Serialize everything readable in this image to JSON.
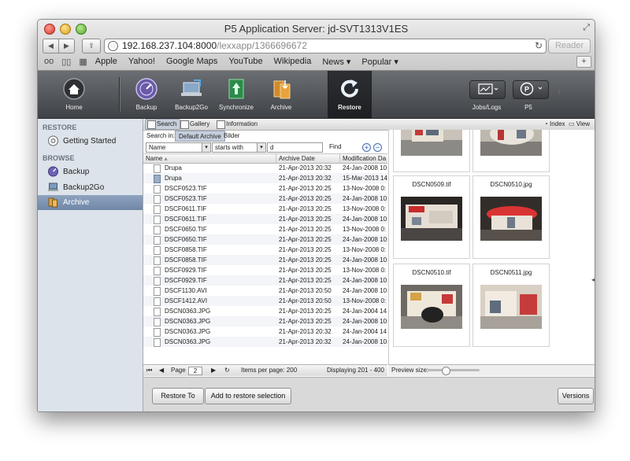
{
  "browser": {
    "window_title": "P5 Application Server: jd-SVT1313V1ES",
    "url_host": "192.168.237.104:8000",
    "url_path": "/lexxapp/1366696672",
    "reader_label": "Reader",
    "bookmarks": [
      "Apple",
      "Yahoo!",
      "Google Maps",
      "YouTube",
      "Wikipedia",
      "News ▾",
      "Popular ▾"
    ]
  },
  "toolbar": {
    "home": "Home",
    "backup": "Backup",
    "backup2go": "Backup2Go",
    "synchronize": "Synchronize",
    "archive": "Archive",
    "restore": "Restore",
    "jobs_logs": "Jobs/Logs",
    "p5": "P5"
  },
  "sidebar": {
    "restore_heading": "RESTORE",
    "getting_started": "Getting Started",
    "browse_heading": "BROWSE",
    "items": [
      "Backup",
      "Backup2Go",
      "Archive"
    ]
  },
  "tabs": {
    "search": "Search",
    "gallery": "Gallery",
    "information": "Information",
    "index": "Index",
    "view": "View"
  },
  "search": {
    "search_in_label": "Search in:",
    "scope_default": "Default Archive",
    "scope_bilder": "Bilder",
    "field": "Name",
    "operator": "starts with",
    "value": "d",
    "find_label": "Find"
  },
  "grid": {
    "columns": [
      "Name",
      "Archive Date",
      "Modification Da"
    ],
    "rows": [
      {
        "name": "Drupa",
        "archived": "21-Apr-2013 20:32",
        "modified": "24-Jan-2008 10:",
        "folder": false
      },
      {
        "name": "Drupa",
        "archived": "21-Apr-2013 20:32",
        "modified": "15-Mar-2013 14",
        "folder": true
      },
      {
        "name": "DSCF0523.TIF",
        "archived": "21-Apr-2013 20:25",
        "modified": "13-Nov-2008 0:",
        "folder": false
      },
      {
        "name": "DSCF0523.TIF",
        "archived": "21-Apr-2013 20:25",
        "modified": "24-Jan-2008 10:",
        "folder": false
      },
      {
        "name": "DSCF0611.TIF",
        "archived": "21-Apr-2013 20:25",
        "modified": "13-Nov-2008 0:",
        "folder": false
      },
      {
        "name": "DSCF0611.TIF",
        "archived": "21-Apr-2013 20:25",
        "modified": "24-Jan-2008 10:",
        "folder": false
      },
      {
        "name": "DSCF0650.TIF",
        "archived": "21-Apr-2013 20:25",
        "modified": "13-Nov-2008 0:",
        "folder": false
      },
      {
        "name": "DSCF0650.TIF",
        "archived": "21-Apr-2013 20:25",
        "modified": "24-Jan-2008 10:",
        "folder": false
      },
      {
        "name": "DSCF0858.TIF",
        "archived": "21-Apr-2013 20:25",
        "modified": "13-Nov-2008 0:",
        "folder": false
      },
      {
        "name": "DSCF0858.TIF",
        "archived": "21-Apr-2013 20:25",
        "modified": "24-Jan-2008 10:",
        "folder": false
      },
      {
        "name": "DSCF0929.TIF",
        "archived": "21-Apr-2013 20:25",
        "modified": "13-Nov-2008 0:",
        "folder": false
      },
      {
        "name": "DSCF0929.TIF",
        "archived": "21-Apr-2013 20:25",
        "modified": "24-Jan-2008 10:",
        "folder": false
      },
      {
        "name": "DSCF1130.AVI",
        "archived": "21-Apr-2013 20:50",
        "modified": "24-Jan-2008 10:",
        "folder": false
      },
      {
        "name": "DSCF1412.AVI",
        "archived": "21-Apr-2013 20:50",
        "modified": "13-Nov-2008 0:",
        "folder": false
      },
      {
        "name": "DSCN0363.JPG",
        "archived": "21-Apr-2013 20:25",
        "modified": "24-Jan-2004 14",
        "folder": false
      },
      {
        "name": "DSCN0363.JPG",
        "archived": "21-Apr-2013 20:25",
        "modified": "24-Jan-2008 10:",
        "folder": false
      },
      {
        "name": "DSCN0363.JPG",
        "archived": "21-Apr-2013 20:32",
        "modified": "24-Jan-2004 14",
        "folder": false
      },
      {
        "name": "DSCN0363.JPG",
        "archived": "21-Apr-2013 20:32",
        "modified": "24-Jan-2008 10:",
        "folder": false
      }
    ]
  },
  "pager": {
    "page_label": "Page",
    "page_value": "2",
    "items_per_page": "Items per page: 200",
    "displaying": "Displaying 201 - 400"
  },
  "gallery": {
    "items": [
      {
        "label": "",
        "top_cropped": true
      },
      {
        "label": "",
        "top_cropped": true
      },
      {
        "label": "DSCN0509.tif"
      },
      {
        "label": "DSCN0510.jpg"
      },
      {
        "label": "DSCN0510.tif"
      },
      {
        "label": "DSCN0511.jpg"
      }
    ],
    "preview_size_label": "Preview size:"
  },
  "actions": {
    "restore_to": "Restore To",
    "add_to_selection": "Add to restore selection",
    "versions": "Versions"
  },
  "colors": {
    "accent": "#6f86a7",
    "toolbar_dark": "#3f4246"
  }
}
